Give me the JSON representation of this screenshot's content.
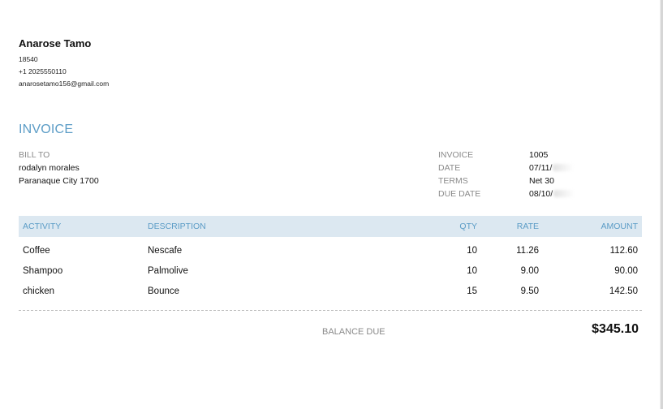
{
  "company": {
    "name": "Anarose Tamo",
    "line1": "18540",
    "phone": "+1 2025550110",
    "email": "anarosetamo156@gmail.com"
  },
  "invoice_title": "INVOICE",
  "bill_to": {
    "label": "BILL TO",
    "name": "rodalyn morales",
    "address": "Paranaque City  1700"
  },
  "meta": {
    "invoice_label": "INVOICE",
    "invoice_value": "1005",
    "date_label": "DATE",
    "date_value": "07/11/",
    "terms_label": "TERMS",
    "terms_value": "Net 30",
    "due_label": "DUE DATE",
    "due_value": "08/10/"
  },
  "table": {
    "headers": {
      "activity": "ACTIVITY",
      "description": "DESCRIPTION",
      "qty": "QTY",
      "rate": "RATE",
      "amount": "AMOUNT"
    },
    "rows": [
      {
        "activity": "Coffee",
        "description": "Nescafe",
        "qty": "10",
        "rate": "11.26",
        "amount": "112.60"
      },
      {
        "activity": "Shampoo",
        "description": "Palmolive",
        "qty": "10",
        "rate": "9.00",
        "amount": "90.00"
      },
      {
        "activity": "chicken",
        "description": "Bounce",
        "qty": "15",
        "rate": "9.50",
        "amount": "142.50"
      }
    ]
  },
  "balance": {
    "label": "BALANCE DUE",
    "value": "$345.10"
  }
}
